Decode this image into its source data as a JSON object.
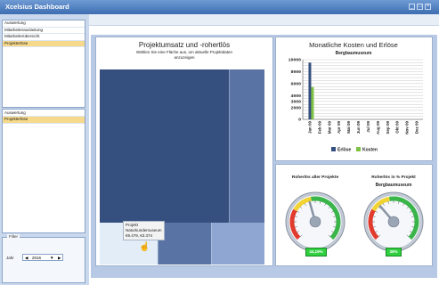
{
  "window": {
    "title": "Xcelsius Dashboard"
  },
  "nav_top": {
    "items": [
      {
        "label": "Auswertung"
      },
      {
        "label": "Mitarbeiterauslastung"
      },
      {
        "label": "Mitarbeiterübersicht"
      },
      {
        "label": "Projekterlöse",
        "selected": true
      }
    ]
  },
  "nav_bottom": {
    "header": "Auswertung",
    "items": [
      {
        "label": "Projekterlöse",
        "selected": true
      }
    ]
  },
  "filter": {
    "legend": "Filter",
    "year_label": "Jahr",
    "year_value": "2016"
  },
  "treemap": {
    "title": "Projektumsatz und -rohertlös",
    "subtitle_line1": "Wählen Sie eine Fläche aus, um aktuelle Projektdaten",
    "subtitle_line2": "anzuzeigen",
    "tooltip": {
      "line1": "Projekt",
      "line2": "Naturkundemuseum",
      "line3": "€9.479, €3.374"
    }
  },
  "chart_data": [
    {
      "type": "bar",
      "title": "Monatliche Kosten und Erlöse",
      "subtitle": "Bergbaumuseum",
      "categories": [
        "Jan 09",
        "Feb 09",
        "Mar 09",
        "Apr 09",
        "Mai 09",
        "Jun 09",
        "Jul 09",
        "Aug 09",
        "Sep 09",
        "Okt 09",
        "Nov 09",
        "Dez 09"
      ],
      "series": [
        {
          "name": "Erlöse",
          "color": "#35507f",
          "values": [
            9500,
            0,
            0,
            0,
            0,
            0,
            0,
            0,
            0,
            0,
            0,
            0
          ]
        },
        {
          "name": "Kosten",
          "color": "#7dc242",
          "values": [
            5400,
            0,
            0,
            0,
            0,
            0,
            0,
            0,
            0,
            0,
            0,
            0
          ]
        }
      ],
      "yticks": [
        "10000",
        "8000",
        "6000",
        "4000",
        "3000",
        "2000",
        "0"
      ],
      "ylim": [
        0,
        10000
      ],
      "grid": true,
      "legend": "bottom"
    }
  ],
  "gauges": [
    {
      "title": "Roherlös aller Projekte",
      "subtitle": "",
      "value_text": "44,19%",
      "value": 44.19
    },
    {
      "title": "Roherlös in % Projekt",
      "subtitle": "Bergbaumuseum",
      "value_text": "35%",
      "value": 35
    }
  ],
  "colors": {
    "accent": "#3d6db2",
    "selected": "#f6d98a",
    "erloese": "#35507f",
    "kosten": "#7dc242"
  }
}
